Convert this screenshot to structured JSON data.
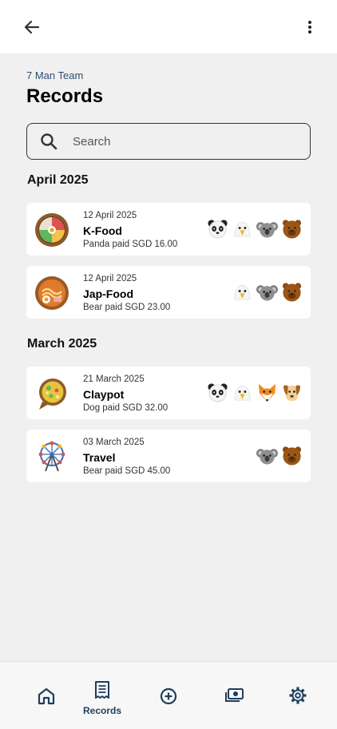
{
  "header": {
    "back_icon": "arrow-left-icon",
    "more_icon": "more-vertical-icon"
  },
  "team_name": "7 Man Team",
  "page_title": "Records",
  "search": {
    "placeholder": "Search",
    "value": ""
  },
  "sections": [
    {
      "month": "April 2025",
      "records": [
        {
          "date": "12 April 2025",
          "name": "K-Food",
          "paid": "Panda paid SGD 16.00",
          "icon": "bibimbap-icon",
          "members": [
            "panda",
            "eagle",
            "koala",
            "bear"
          ]
        },
        {
          "date": "12 April 2025",
          "name": "Jap-Food",
          "paid": "Bear paid SGD 23.00",
          "icon": "ramen-icon",
          "members": [
            "eagle",
            "koala",
            "bear"
          ]
        }
      ]
    },
    {
      "month": "March 2025",
      "records": [
        {
          "date": "21 March 2025",
          "name": "Claypot",
          "paid": "Dog paid SGD 32.00",
          "icon": "claypot-icon",
          "members": [
            "panda",
            "eagle",
            "fox",
            "dog"
          ]
        },
        {
          "date": "03 March 2025",
          "name": "Travel",
          "paid": "Bear paid SGD 45.00",
          "icon": "ferris-wheel-icon",
          "members": [
            "koala",
            "bear"
          ]
        }
      ]
    }
  ],
  "bottom_nav": {
    "home_icon": "home-icon",
    "records_icon": "receipt-icon",
    "records_label": "Records",
    "add_icon": "add-circle-icon",
    "money_icon": "money-icon",
    "settings_icon": "settings-icon"
  },
  "colors": {
    "accent": "#1e3d5c",
    "background": "#f0f0f0",
    "card": "#ffffff"
  }
}
